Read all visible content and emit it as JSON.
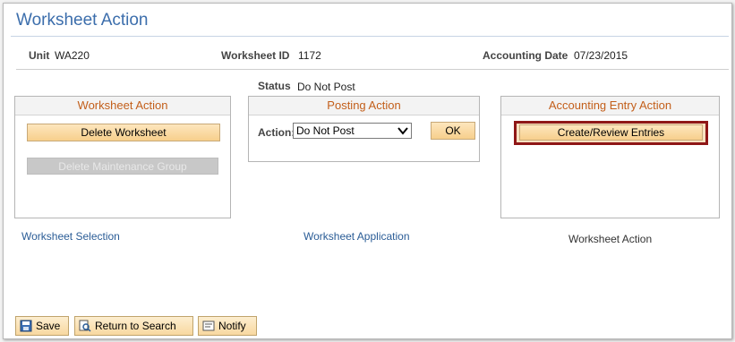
{
  "page": {
    "title": "Worksheet Action"
  },
  "header": {
    "unit_label": "Unit",
    "unit_value": "WA220",
    "worksheet_id_label": "Worksheet ID",
    "worksheet_id_value": "1172",
    "accounting_date_label": "Accounting Date",
    "accounting_date_value": "07/23/2015",
    "status_label": "Status",
    "status_value": "Do Not Post"
  },
  "worksheet_action_box": {
    "header": "Worksheet Action",
    "delete_worksheet": "Delete Worksheet",
    "delete_maintenance_group": "Delete Maintenance Group"
  },
  "posting_action_box": {
    "header": "Posting Action",
    "action_label": "Action:",
    "action_value": "Do Not Post",
    "ok_label": "OK"
  },
  "accounting_entry_box": {
    "header": "Accounting Entry Action",
    "create_review": "Create/Review Entries"
  },
  "links": {
    "worksheet_selection": "Worksheet Selection",
    "worksheet_application": "Worksheet Application",
    "worksheet_action": "Worksheet Action"
  },
  "toolbar": {
    "save": "Save",
    "return_to_search": "Return to Search",
    "notify": "Notify"
  },
  "colors": {
    "title": "#3c6eac",
    "box_header": "#c35f1b",
    "link": "#2a5c96",
    "highlight_border": "#8f1717"
  },
  "icons": [
    "save-icon",
    "return-to-search-icon",
    "notify-icon",
    "dropdown-arrow-icon"
  ]
}
